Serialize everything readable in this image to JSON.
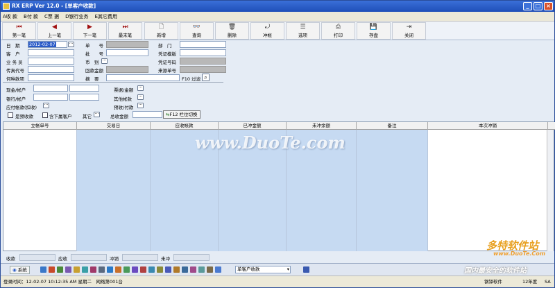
{
  "window": {
    "title": "RX ERP Ver 12.0 - [单客户收款]"
  },
  "menu": [
    "A收 款",
    "B付 款",
    "C票 据",
    "D银行业务",
    "E其它费用"
  ],
  "toolbar": [
    {
      "label": "第一笔",
      "icon": "first-record-icon",
      "glyph": "⏮"
    },
    {
      "label": "上一笔",
      "icon": "prev-record-icon",
      "glyph": "◀"
    },
    {
      "label": "下一笔",
      "icon": "next-record-icon",
      "glyph": "▶"
    },
    {
      "label": "最末笔",
      "icon": "last-record-icon",
      "glyph": "⏭"
    },
    {
      "label": "新增",
      "icon": "new-doc-icon",
      "glyph": "🗋"
    },
    {
      "label": "查询",
      "icon": "binoculars-icon",
      "glyph": "👓"
    },
    {
      "label": "删除",
      "icon": "trash-icon",
      "glyph": "🗑"
    },
    {
      "label": "冲帐",
      "icon": "offset-icon",
      "glyph": "⤾"
    },
    {
      "label": "选项",
      "icon": "options-icon",
      "glyph": "☰"
    },
    {
      "label": "打印",
      "icon": "printer-icon",
      "glyph": "⎙"
    },
    {
      "label": "存盘",
      "icon": "save-disk-icon",
      "glyph": "💾"
    },
    {
      "label": "关闭",
      "icon": "exit-icon",
      "glyph": "⇥"
    }
  ],
  "form": {
    "date_label": "日　期",
    "date_value": "2012-02-07",
    "customer_label": "客　户",
    "salesperson_label": "业 务 员",
    "fax_label": "传真代号",
    "delivery_label": "何种款项",
    "doc_no_label": "单　　号",
    "batch_label": "批　　号",
    "currency_label": "币　别",
    "returned_label": "回款金额",
    "summary_label": "摘　要",
    "dept_label": "部　门",
    "voucher_tpl_label": "凭证模版",
    "voucher_no_label": "凭证号码",
    "source_no_label": "来源单号",
    "f10_label": "F10 过滤",
    "cash_label": "现金/帐户",
    "bank_label": "银行/帐户",
    "receivable_label": "应付帐款(扣收)",
    "bill_label": "票据/金额",
    "other_label": "其他帐款",
    "prepay_label": "预收/付款",
    "prepaid_check": "是预收款",
    "sub_cust_check": "含下属客户",
    "other2_label": "其它",
    "total_label": "总收金额",
    "f12_label": "F12 栏位切换"
  },
  "grid": {
    "headers": [
      "立帐单号",
      "交易日",
      "应收帐款",
      "已冲金额",
      "未冲余额",
      "备注",
      "本次冲销"
    ]
  },
  "totals": {
    "labels": [
      "收款",
      "应收",
      "冲销",
      "未冲"
    ]
  },
  "taskbar": {
    "system_label": "系统",
    "combo_value": "单客户收款"
  },
  "status": {
    "login": "登录时间：12-02-07 10:12:35 AM 星期二　网络第001台",
    "software": "钢铎软件",
    "year": "12年度",
    "user": "SA"
  },
  "watermark": {
    "main": "www.DuoTe.com",
    "brand": "多特软件站",
    "brand_url": "www.DuoTe.Com",
    "slogan": "国内最安全的软件站"
  }
}
